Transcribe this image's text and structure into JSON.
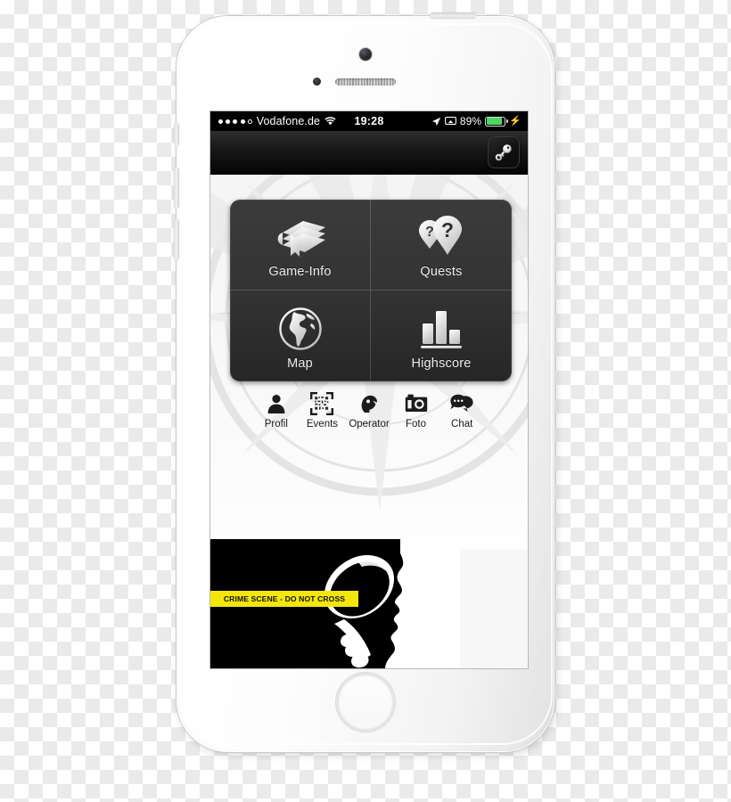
{
  "device": {
    "name": "iPhone 5s",
    "color": "white-silver",
    "hardware": {
      "camera": "front-camera",
      "sensor": "proximity-sensor",
      "speaker": "earpiece-speaker",
      "home": "home-button",
      "mute": "mute-switch",
      "volume_up": "volume-up-button",
      "volume_down": "volume-down-button",
      "power": "power-button"
    }
  },
  "status_bar": {
    "signal_dots_filled": 4,
    "signal_dots_total": 5,
    "carrier": "Vodafone.de",
    "wifi_icon": "wifi-icon",
    "time": "19:28",
    "location_icon": "location-arrow-icon",
    "airplay_icon": "airplay-icon",
    "battery_percent": "89%",
    "battery_level": 89,
    "battery_color": "#4cd764",
    "charging_icon": "lightning-bolt-icon"
  },
  "nav_bar": {
    "title": "",
    "key_button": {
      "label": "",
      "icon": "key-icon"
    },
    "background_color": "#0d0d0d"
  },
  "menu": {
    "tiles": [
      {
        "label": "Game-Info",
        "icon": "book-icon"
      },
      {
        "label": "Quests",
        "icon": "quest-pins-icon"
      },
      {
        "label": "Map",
        "icon": "globe-icon"
      },
      {
        "label": "Highscore",
        "icon": "bar-chart-icon"
      }
    ],
    "panel_color": "#333333"
  },
  "toolbar": {
    "items": [
      {
        "label": "Profil",
        "icon": "person-icon"
      },
      {
        "label": "Events",
        "icon": "qr-scan-icon"
      },
      {
        "label": "Operator",
        "icon": "headset-icon"
      },
      {
        "label": "Foto",
        "icon": "camera-icon"
      },
      {
        "label": "Chat",
        "icon": "chat-bubbles-icon"
      }
    ]
  },
  "banner": {
    "tape_text": "CRIME SCENE - DO NOT CROSS",
    "tape_color": "#f3e60d",
    "background_color": "#000000",
    "artwork": "detective-silhouette-with-magnifying-glass"
  }
}
